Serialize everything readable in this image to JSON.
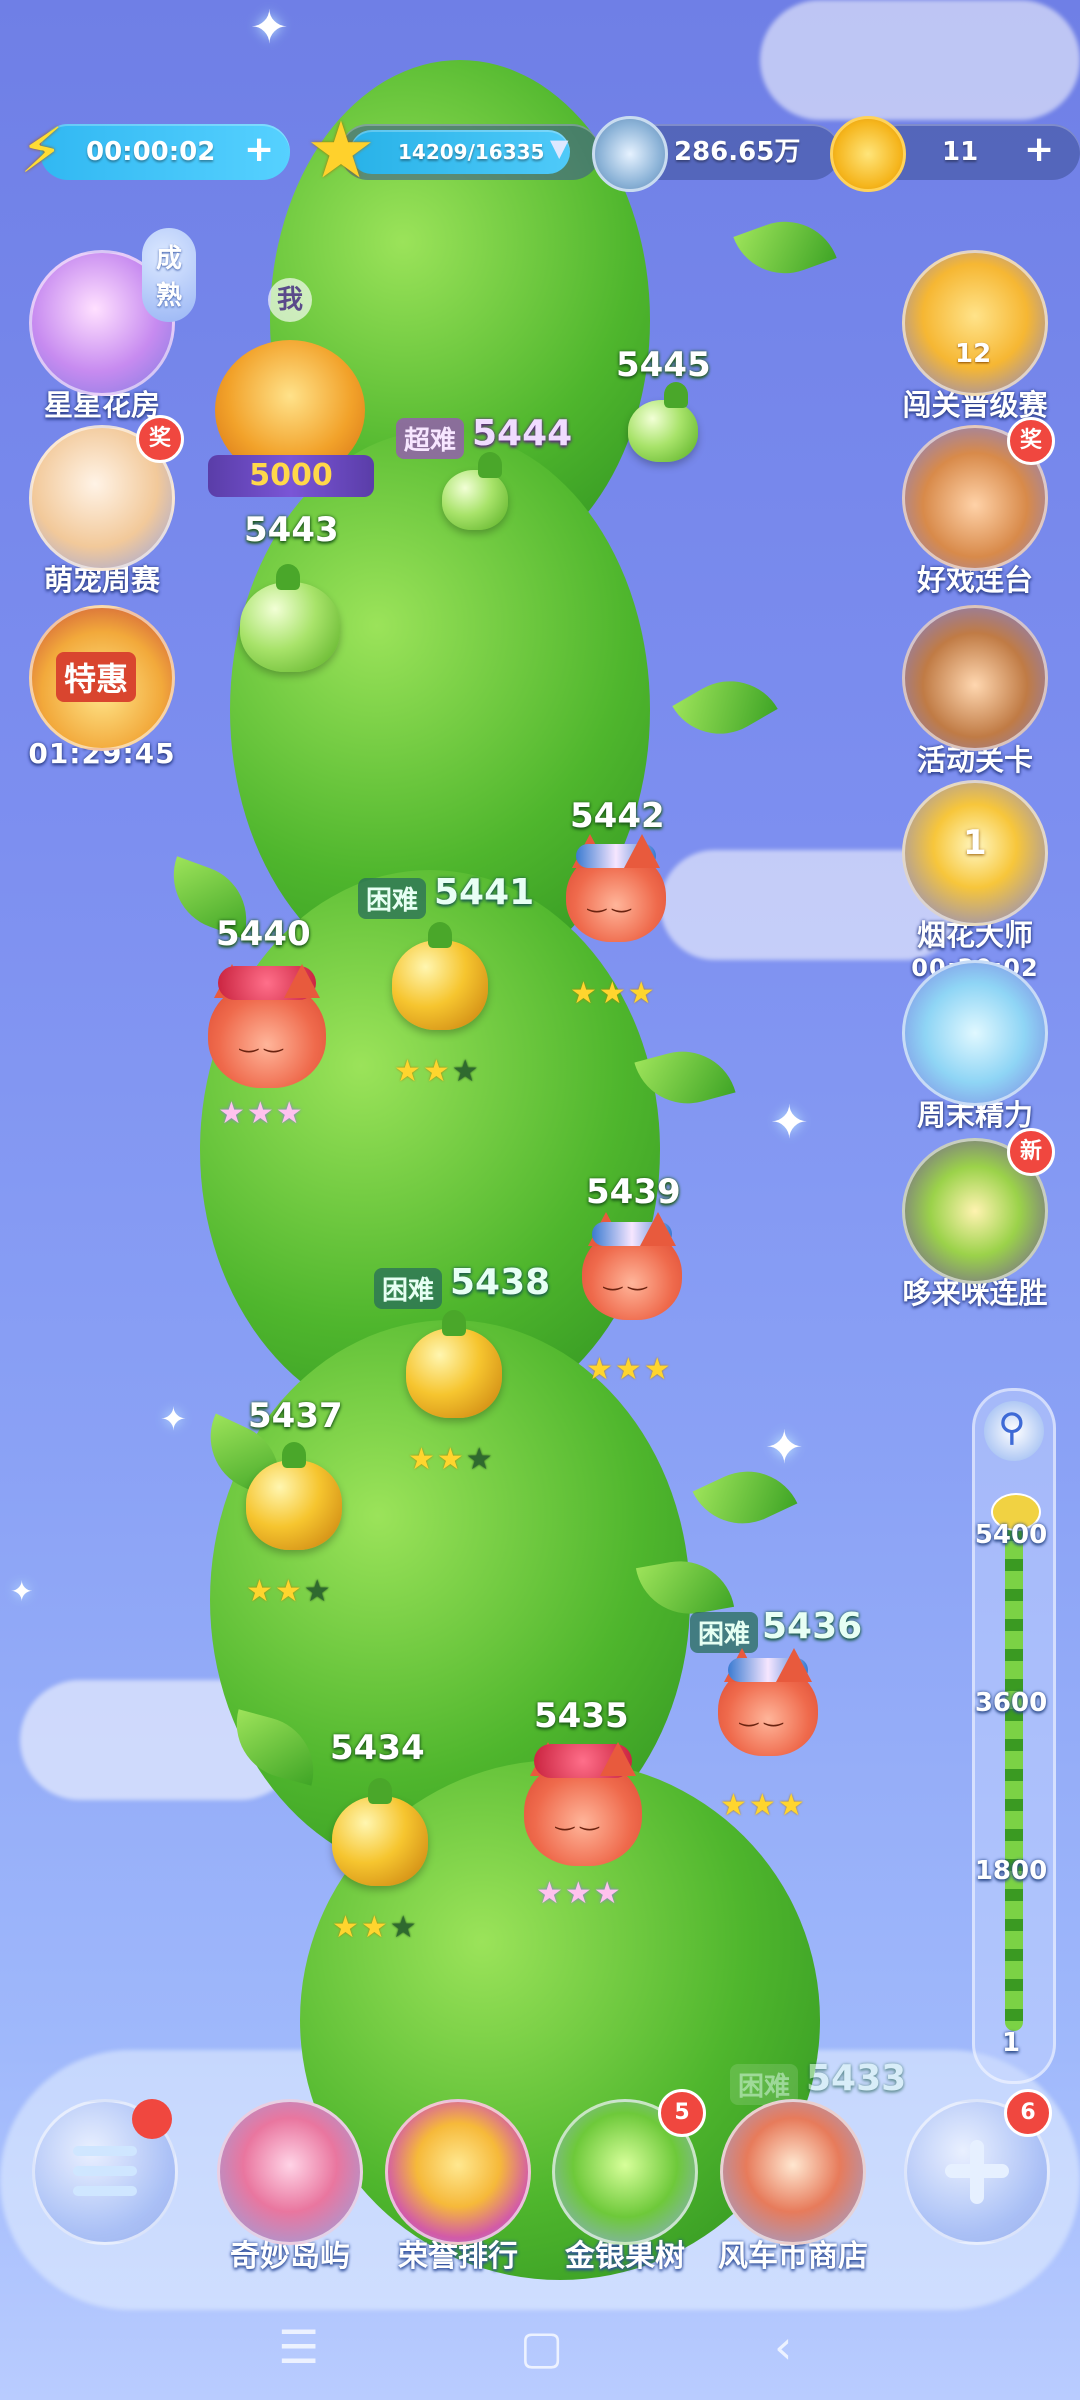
{
  "topbar": {
    "energy_timer": "00:00:02",
    "stars_progress": "14209/16335",
    "wind_coins": "286.65万",
    "gold_coins": "11"
  },
  "left_side": {
    "star_garden": {
      "label": "星星花房",
      "bubble": "成熟"
    },
    "pet_weekly": {
      "label": "萌宠周赛",
      "badge": "奖"
    },
    "special_offer": {
      "title": "特惠",
      "timer": "01:29:45"
    }
  },
  "right_side": {
    "level_league": {
      "label": "闯关晋级赛",
      "rank": "12"
    },
    "show_combo": {
      "label": "好戏连台",
      "badge": "奖"
    },
    "event_levels": {
      "label": "活动关卡"
    },
    "fireworks_master": {
      "label": "烟花大师",
      "timer": "00:30:02",
      "count": "1"
    },
    "weekend_energy": {
      "label": "周末精力"
    },
    "doremi_streak": {
      "label": "哆来咪连胜",
      "badge": "新"
    }
  },
  "player_marker": {
    "tag": "我",
    "score": "5000"
  },
  "levels": [
    {
      "num": "5445",
      "difficulty": "",
      "stars": ""
    },
    {
      "num": "5444",
      "difficulty": "超难",
      "stars": ""
    },
    {
      "num": "5443",
      "difficulty": "",
      "stars": ""
    },
    {
      "num": "5442",
      "difficulty": "",
      "stars": "★★★"
    },
    {
      "num": "5441",
      "difficulty": "困难",
      "stars_on": "★★",
      "stars_off": "★"
    },
    {
      "num": "5440",
      "difficulty": "",
      "stars": "★★★"
    },
    {
      "num": "5439",
      "difficulty": "",
      "stars": "★★★"
    },
    {
      "num": "5438",
      "difficulty": "困难",
      "stars_on": "★★",
      "stars_off": "★"
    },
    {
      "num": "5437",
      "difficulty": "",
      "stars_on": "★★",
      "stars_off": "★"
    },
    {
      "num": "5436",
      "difficulty": "困难",
      "stars": "★★★"
    },
    {
      "num": "5435",
      "difficulty": "",
      "stars": "★★★"
    },
    {
      "num": "5434",
      "difficulty": "",
      "stars_on": "★★",
      "stars_off": "★"
    },
    {
      "num": "5433",
      "difficulty": "困难",
      "stars": ""
    }
  ],
  "progress_markers": [
    "5400",
    "3600",
    "1800",
    "1"
  ],
  "bottom_nav": {
    "items": [
      {
        "label": ""
      },
      {
        "label": "奇妙岛屿"
      },
      {
        "label": "荣誉排行"
      },
      {
        "label": "金银果树",
        "badge": "5"
      },
      {
        "label": "风车币商店"
      },
      {
        "label": "",
        "badge": "6"
      }
    ]
  },
  "colors": {
    "sky": "#7d8ff0",
    "vine": "#4fb62d",
    "badge": "#f0473f",
    "star": "#ffd52e"
  },
  "icons": [
    "lightning-icon",
    "star-icon",
    "windmill-coin-icon",
    "gold-coin-icon",
    "menu-icon",
    "plus-icon",
    "map-pin-icon"
  ]
}
